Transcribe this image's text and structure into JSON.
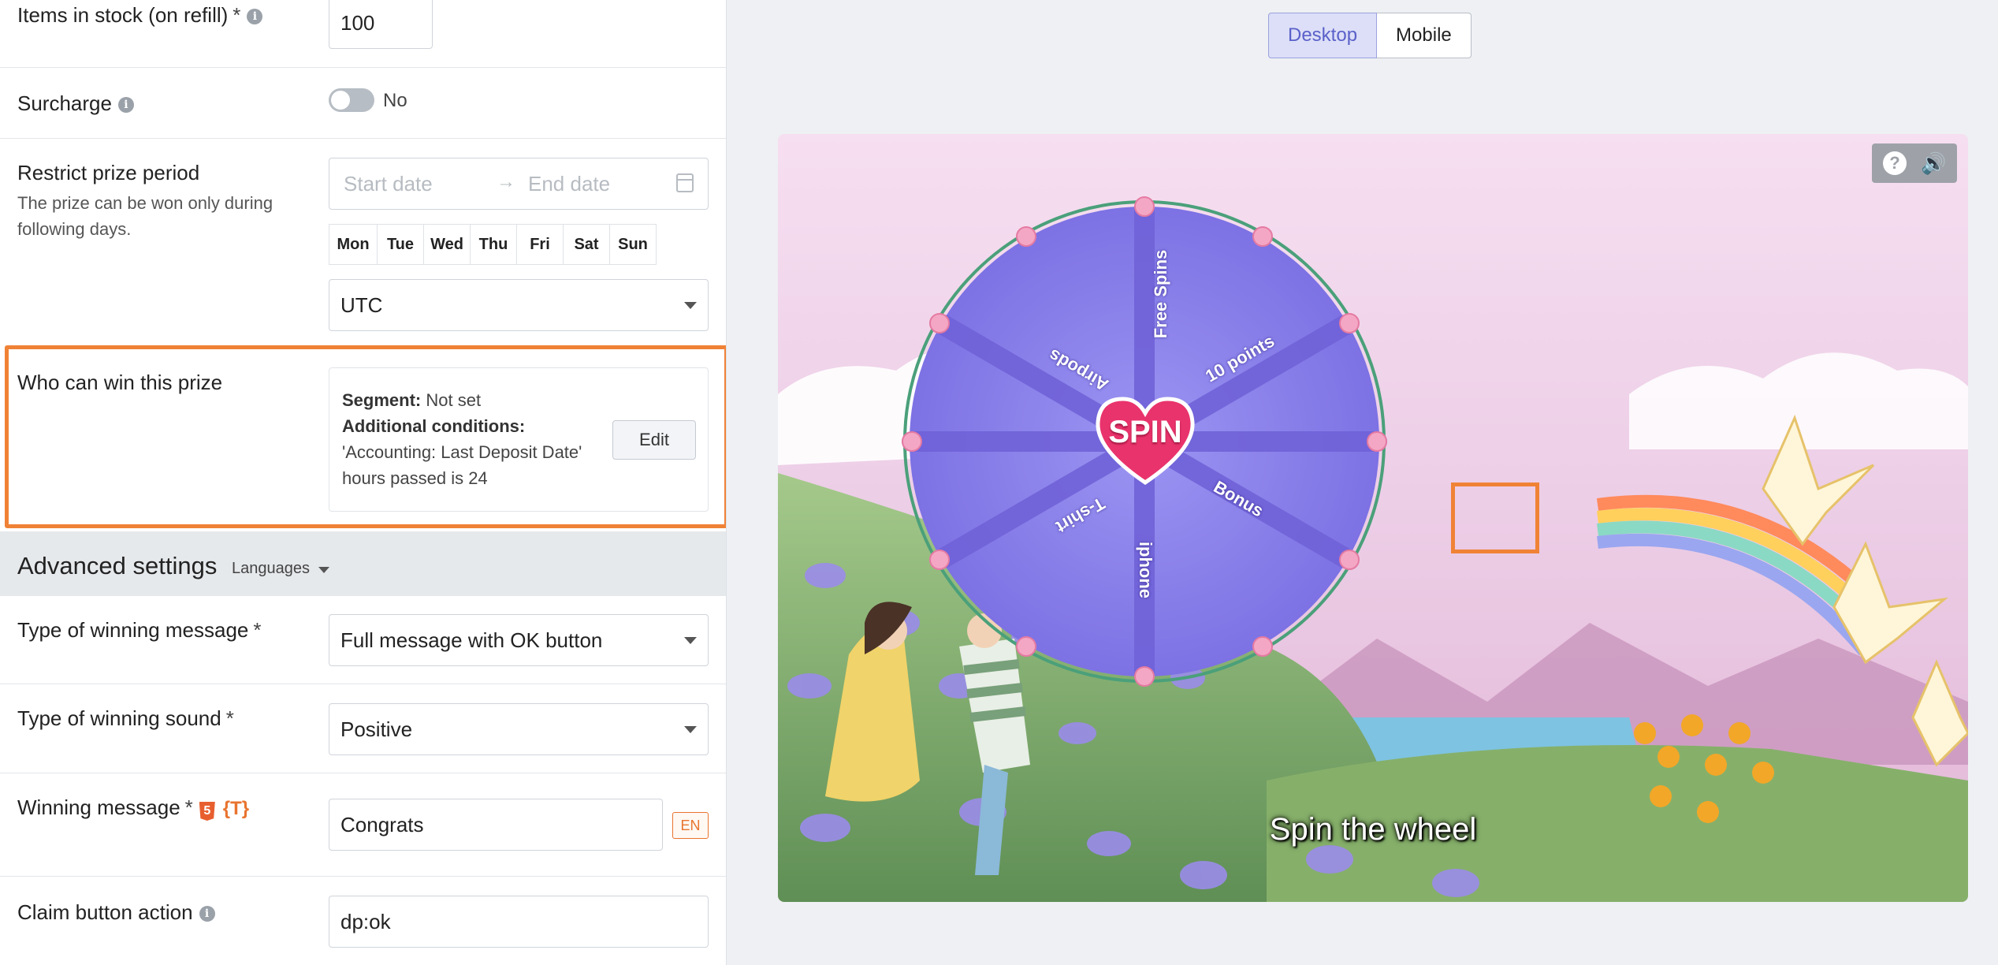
{
  "form": {
    "items_in_stock": {
      "label": "Items in stock (on refill)",
      "required": "*",
      "value": "100"
    },
    "surcharge": {
      "label": "Surcharge",
      "toggle_state": "No"
    },
    "restrict_period": {
      "label": "Restrict prize period",
      "description": "The prize can be won only during following days.",
      "start_placeholder": "Start date",
      "end_placeholder": "End date",
      "arrow": "→",
      "days": [
        "Mon",
        "Tue",
        "Wed",
        "Thu",
        "Fri",
        "Sat",
        "Sun"
      ],
      "timezone": "UTC"
    },
    "who_can_win": {
      "label": "Who can win this prize",
      "segment_label": "Segment:",
      "segment_value": "Not set",
      "conditions_label": "Additional conditions:",
      "conditions_line1": "'Accounting: Last Deposit Date'",
      "conditions_line2": "hours passed is 24",
      "edit_label": "Edit"
    },
    "advanced": {
      "title": "Advanced settings",
      "languages_label": "Languages"
    },
    "winning_message_type": {
      "label": "Type of winning message",
      "required": "*",
      "value": "Full message with OK button"
    },
    "winning_sound": {
      "label": "Type of winning sound",
      "required": "*",
      "value": "Positive"
    },
    "winning_message": {
      "label": "Winning message",
      "required": "*",
      "html_icon": "5",
      "template_icon": "{T}",
      "value": "Congrats",
      "lang": "EN"
    },
    "claim_action": {
      "label": "Claim button action",
      "value": "dp:ok"
    }
  },
  "preview": {
    "tabs": [
      "Desktop",
      "Mobile"
    ],
    "active_tab": "Desktop",
    "help_glyph": "?",
    "speaker_glyph": "🔊",
    "wheel": {
      "center_label": "SPIN",
      "segments": [
        "Free Spins",
        "10 points",
        "Bonus",
        "iphone",
        "T-shirt",
        "Airpods"
      ]
    },
    "cta": "Spin the wheel"
  },
  "colors": {
    "highlight": "#f08236",
    "active_tab_bg": "#dcdff7",
    "active_tab_text": "#5b61c9",
    "wheel_fill": "#8f86ec",
    "spin_heart": "#e9336c"
  }
}
